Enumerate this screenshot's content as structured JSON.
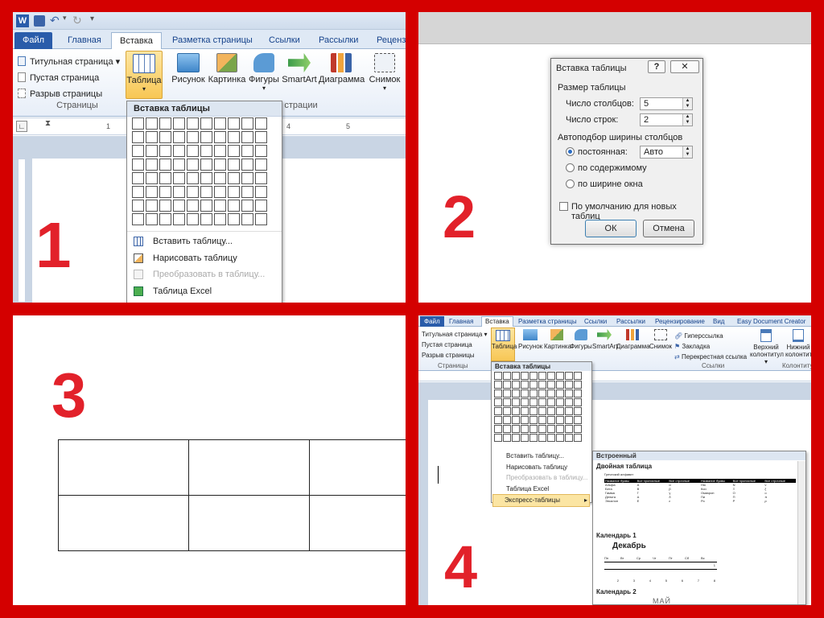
{
  "panel_numbers": [
    "1",
    "2",
    "3",
    "4"
  ],
  "word": {
    "tabs": [
      "Файл",
      "Главная",
      "Вставка",
      "Разметка страницы",
      "Ссылки",
      "Рассылки",
      "Рецензирование",
      "Вид",
      "Easy Document Creator"
    ],
    "tab_rece_cut": "Реценз",
    "pages_group": {
      "items": [
        "Титульная страница ▾",
        "Пустая страница",
        "Разрыв страницы"
      ],
      "label": "Страницы"
    },
    "ribbon_buttons": [
      "Таблица",
      "Рисунок",
      "Картинка",
      "Фигуры",
      "SmartArt",
      "Диаграмма",
      "Снимок"
    ],
    "illustrations_label_cut": "страции",
    "links_group": {
      "items": [
        "Гиперссылка",
        "Закладка",
        "Перекрестная ссылка"
      ],
      "label": "Ссылки"
    },
    "header_buttons": [
      "Верхний колонтитул ▾",
      "Нижний колонтиту"
    ],
    "header_group_label": "Колонтиту",
    "table_menu": {
      "header": "Вставка таблицы",
      "items": [
        "Вставить таблицу...",
        "Нарисовать таблицу",
        "Преобразовать в таблицу...",
        "Таблица Excel",
        "Экспресс-таблицы"
      ]
    },
    "ruler_numbers": [
      "1",
      "4",
      "5"
    ]
  },
  "dialog": {
    "title": "Вставка таблицы",
    "help": "?",
    "close": "✕",
    "size_section": "Размер таблицы",
    "columns_label": "Число столбцов:",
    "columns_value": "5",
    "rows_label": "Число строк:",
    "rows_value": "2",
    "autofit_section": "Автоподбор ширины столбцов",
    "radio_fixed": "постоянная:",
    "fixed_value": "Авто",
    "radio_content": "по содержимому",
    "radio_window": "по ширине окна",
    "default_checkbox": "По умолчанию для новых таблиц",
    "ok": "ОК",
    "cancel": "Отмена"
  },
  "gallery": {
    "header": "Встроенный",
    "item1": "Двойная таблица",
    "item1_caption": "Греческий алфавит",
    "item1_headers": [
      "Название буквы",
      "Все прописные",
      "Все строчные",
      "Название буквы",
      "Все прописные",
      "Все строчные"
    ],
    "item1_rows": [
      [
        "Альфа",
        "А",
        "α",
        "Ню",
        "N",
        "ν"
      ],
      [
        "Бета",
        "В",
        "β",
        "Кси",
        "Ξ",
        "ξ"
      ],
      [
        "Гамма",
        "Г",
        "γ",
        "Омикрон",
        "О",
        "о"
      ],
      [
        "Дельта",
        "Δ",
        "δ",
        "Пи",
        "П",
        "π"
      ],
      [
        "Эпсилон",
        "Е",
        "ε",
        "Ро",
        "Р",
        "ρ"
      ]
    ],
    "item2": "Календарь 1",
    "cal_month": "Декабрь",
    "cal_days": [
      "Пн",
      "Вт",
      "Ср",
      "Чт",
      "Пт",
      "Сб",
      "Вс"
    ],
    "cal_row1": [
      "",
      "",
      "",
      "",
      "",
      "",
      "1"
    ],
    "cal_row2": [
      "2",
      "3",
      "4",
      "5",
      "6",
      "7",
      "8"
    ],
    "item3": "Календарь 2",
    "cal2_month": "МАЙ"
  },
  "colors": {
    "frame": "#d40000",
    "number": "#e2212a",
    "file_tab": "#2a5caa",
    "accent": "#2a6cc4"
  }
}
